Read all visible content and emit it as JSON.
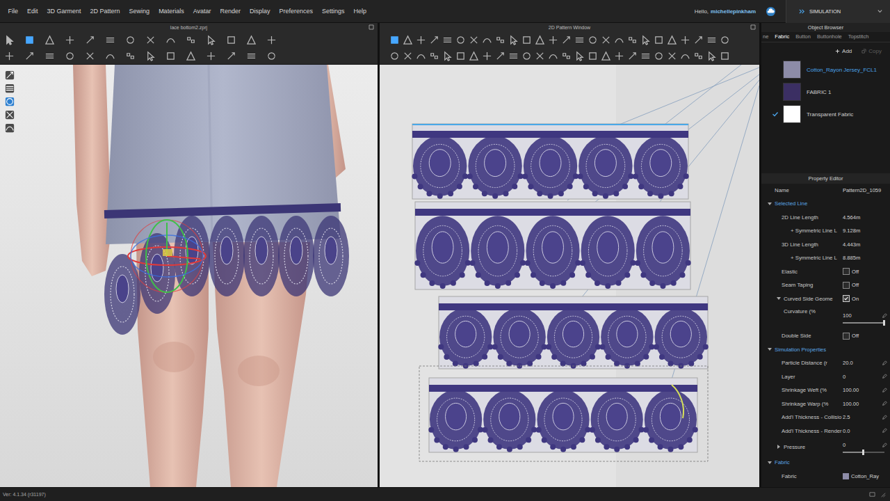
{
  "menu": [
    "File",
    "Edit",
    "3D Garment",
    "2D Pattern",
    "Sewing",
    "Materials",
    "Avatar",
    "Render",
    "Display",
    "Preferences",
    "Settings",
    "Help"
  ],
  "account": {
    "greeting": "Hello,",
    "user": "michellepinkham"
  },
  "mode": {
    "label": "SIMULATION"
  },
  "views": {
    "garment3d": {
      "title": "lace bottom2.zprj"
    },
    "pattern2d": {
      "title": "2D Pattern Window"
    }
  },
  "toolbars": {
    "garment3d": [
      [
        {
          "selected": false
        },
        {
          "selected": true
        },
        {
          "selected": false
        },
        {
          "selected": false
        },
        {
          "selected": false
        },
        {
          "selected": false
        },
        {
          "selected": false
        },
        {
          "selected": false
        },
        {
          "selected": false
        },
        {
          "selected": false
        },
        {
          "selected": false
        },
        {
          "selected": false
        },
        {
          "selected": false
        },
        {
          "selected": false
        }
      ],
      [
        {
          "selected": false
        },
        {
          "selected": false
        },
        {
          "selected": false
        },
        {
          "selected": false
        },
        {
          "selected": false
        },
        {
          "selected": false
        },
        {
          "selected": false
        },
        {
          "selected": false
        },
        {
          "selected": false
        },
        {
          "selected": false
        },
        {
          "selected": false
        },
        {
          "selected": false
        },
        {
          "selected": false
        },
        {
          "selected": false
        }
      ]
    ],
    "pattern2d": [
      [
        {
          "selected": true
        },
        {
          "selected": false
        },
        {
          "selected": false
        },
        {
          "selected": false
        },
        {
          "selected": false
        },
        {
          "selected": false
        },
        {
          "selected": false
        },
        {
          "selected": false
        },
        {
          "selected": false
        },
        {
          "selected": false
        },
        {
          "selected": false
        },
        {
          "selected": false
        },
        {
          "selected": false
        },
        {
          "selected": false
        },
        {
          "selected": false
        },
        {
          "selected": false
        },
        {
          "selected": false
        },
        {
          "selected": false
        },
        {
          "selected": false
        },
        {
          "selected": false
        },
        {
          "selected": false
        },
        {
          "selected": false
        },
        {
          "selected": false
        },
        {
          "selected": false
        },
        {
          "selected": false
        },
        {
          "selected": false
        }
      ],
      [
        {
          "selected": false
        },
        {
          "selected": false
        },
        {
          "selected": false
        },
        {
          "selected": false
        },
        {
          "selected": false
        },
        {
          "selected": false
        },
        {
          "selected": false
        },
        {
          "selected": false
        },
        {
          "selected": false
        },
        {
          "selected": false
        },
        {
          "selected": false
        },
        {
          "selected": false
        },
        {
          "selected": false
        },
        {
          "selected": false
        },
        {
          "selected": false
        },
        {
          "selected": false
        },
        {
          "selected": false
        },
        {
          "selected": false
        },
        {
          "selected": false
        },
        {
          "selected": false
        },
        {
          "selected": false
        },
        {
          "selected": false
        },
        {
          "selected": false
        },
        {
          "selected": false
        },
        {
          "selected": false
        },
        {
          "selected": false
        }
      ]
    ],
    "viewportTools": [
      {
        "selected": false
      },
      {
        "selected": false
      },
      {
        "selected": true
      },
      {
        "selected": false
      },
      {
        "selected": false
      }
    ]
  },
  "objectBrowser": {
    "title": "Object Browser",
    "tabs": [
      {
        "label": "ne",
        "selected": false
      },
      {
        "label": "Fabric",
        "selected": true
      },
      {
        "label": "Button",
        "selected": false
      },
      {
        "label": "Buttonhole",
        "selected": false
      },
      {
        "label": "Topstitch",
        "selected": false
      }
    ],
    "actions": [
      {
        "label": "Add",
        "disabled": false
      },
      {
        "label": "Copy",
        "disabled": true
      }
    ],
    "fabrics": [
      {
        "name": "Cotton_Rayon Jersey_FCL1",
        "color": "#8d8ca8",
        "selected": true,
        "checked": false
      },
      {
        "name": "FABRIC 1",
        "color": "#3b2f63",
        "selected": false,
        "checked": false
      },
      {
        "name": "Transparent Fabric",
        "color": "#ffffff",
        "selected": false,
        "checked": true
      }
    ]
  },
  "propertyEditor": {
    "title": "Property Editor",
    "rows": [
      {
        "kind": "field",
        "label": "Name",
        "value": "Pattern2D_1059",
        "editable": false
      },
      {
        "kind": "section",
        "label": "Selected Line",
        "expanded": true
      },
      {
        "kind": "value",
        "label": "2D Line Length",
        "value": "4.564m",
        "editable": false
      },
      {
        "kind": "subvalue",
        "label": "+ Symmetric Line L",
        "value": "9.128m",
        "editable": false
      },
      {
        "kind": "value",
        "label": "3D Line Length",
        "value": "4.443m",
        "editable": false
      },
      {
        "kind": "subvalue",
        "label": "+ Symmetric Line L",
        "value": "8.885m",
        "editable": false
      },
      {
        "kind": "toggle",
        "label": "Elastic",
        "value": "Off",
        "checked": false
      },
      {
        "kind": "toggle",
        "label": "Seam Taping",
        "value": "Off",
        "checked": false
      },
      {
        "kind": "group-toggle",
        "label": "Curved Side Geome",
        "value": "On",
        "checked": true,
        "expanded": true
      },
      {
        "kind": "slider",
        "label": "Curvature (%",
        "value": "100",
        "level": 1.0,
        "editable": true
      },
      {
        "kind": "toggle",
        "label": "Double Side",
        "value": "Off",
        "checked": false
      },
      {
        "kind": "section",
        "label": "Simulation Properties",
        "expanded": true
      },
      {
        "kind": "value",
        "label": "Particle Distance (r",
        "value": "20.0",
        "editable": true
      },
      {
        "kind": "value",
        "label": "Layer",
        "value": "0",
        "editable": true
      },
      {
        "kind": "value",
        "label": "Shrinkage Weft (%",
        "value": "100.00",
        "editable": true
      },
      {
        "kind": "value",
        "label": "Shrinkage Warp (%",
        "value": "100.00",
        "editable": true
      },
      {
        "kind": "value",
        "label": "Add'l Thickness - Collisio",
        "value": "2.5",
        "editable": true
      },
      {
        "kind": "value",
        "label": "Add'l Thickness - Render",
        "value": "0.0",
        "editable": true
      },
      {
        "kind": "group-slider",
        "label": "Pressure",
        "value": "0",
        "level": 0.5,
        "expanded": false,
        "editable": true
      },
      {
        "kind": "section",
        "label": "Fabric",
        "expanded": true
      },
      {
        "kind": "swatch",
        "label": "Fabric",
        "value": "Cotton_Ray",
        "color": "#8d8ca8"
      }
    ]
  },
  "status": {
    "version": "Ver: 4.1.34 (r31197)"
  }
}
